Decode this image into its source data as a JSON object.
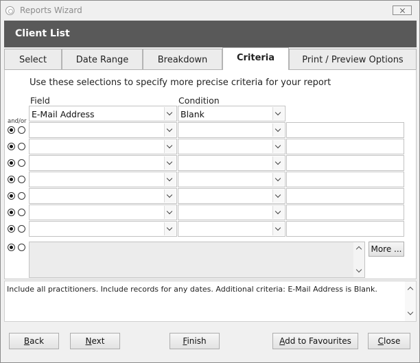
{
  "window": {
    "title": "Reports Wizard"
  },
  "header": {
    "title": "Client List"
  },
  "tabs": [
    {
      "label": "Select"
    },
    {
      "label": "Date Range"
    },
    {
      "label": "Breakdown"
    },
    {
      "label": "Criteria",
      "active": true
    },
    {
      "label": "Print / Preview Options"
    }
  ],
  "criteria": {
    "instruction": "Use these selections to specify more precise criteria for your report",
    "field_label": "Field",
    "condition_label": "Condition",
    "andor_label": "and/or",
    "rows": [
      {
        "field": "E-Mail Address",
        "condition": "Blank",
        "andor": null
      },
      {
        "field": "",
        "condition": "",
        "andor": "and"
      },
      {
        "field": "",
        "condition": "",
        "andor": "and"
      },
      {
        "field": "",
        "condition": "",
        "andor": "and"
      },
      {
        "field": "",
        "condition": "",
        "andor": "and"
      },
      {
        "field": "",
        "condition": "",
        "andor": "and"
      },
      {
        "field": "",
        "condition": "",
        "andor": "and"
      },
      {
        "field": "",
        "condition": "",
        "andor": "and"
      }
    ],
    "memo_andor": "and",
    "more_button": "More ..."
  },
  "summary": {
    "text": "Include all practitioners. Include records for any dates. Additional criteria: E-Mail Address is Blank."
  },
  "buttons": {
    "back": {
      "accel": "B",
      "rest": "ack"
    },
    "next": {
      "accel": "N",
      "rest": "ext"
    },
    "finish": {
      "accel": "F",
      "rest": "inish"
    },
    "favourites": {
      "pre": "",
      "accel": "A",
      "rest": "dd to Favourites"
    },
    "close": {
      "accel": "C",
      "rest": "lose"
    }
  },
  "icons": [
    "app-icon",
    "close-icon",
    "chevron-down-icon",
    "scroll-up-icon",
    "scroll-down-icon"
  ]
}
